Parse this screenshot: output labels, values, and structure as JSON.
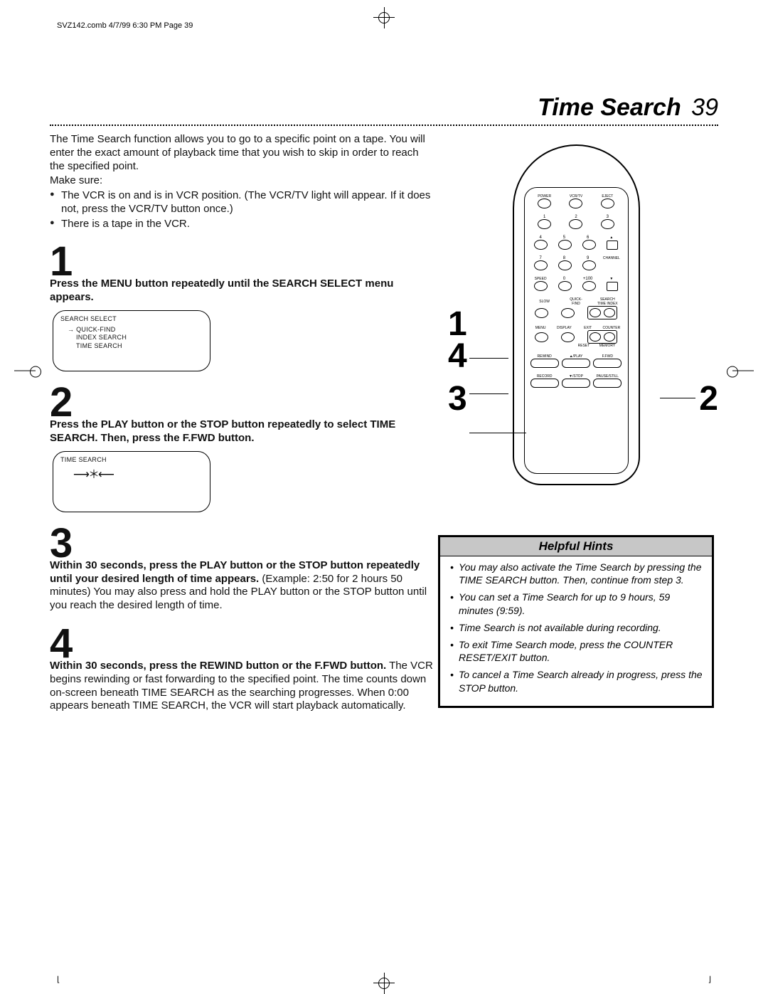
{
  "slug": "SVZ142.comb  4/7/99  6:30 PM  Page 39",
  "title": "Time Search",
  "page_number": "39",
  "intro": "The Time Search function allows you to go to a specific point on a tape. You will enter the exact amount of playback time that you wish to skip in order to reach the specified point.",
  "make_sure_label": "Make sure:",
  "make_sure": [
    "The VCR is on and is in VCR position. (The VCR/TV light will appear. If it does not, press the VCR/TV button once.)",
    "There is a tape in the VCR."
  ],
  "steps": {
    "s1": {
      "num": "1",
      "bold": "Press the MENU button repeatedly until the SEARCH SELECT menu appears."
    },
    "s2": {
      "num": "2",
      "bold": "Press the PLAY button or the STOP button repeatedly to select TIME SEARCH. Then, press the F.FWD button."
    },
    "s3": {
      "num": "3",
      "bold": "Within 30 seconds, press the PLAY button or the STOP button repeatedly until your desired length of time appears.",
      "rest": "  (Example: 2:50 for 2 hours 50 minutes) You may also press and hold the PLAY button or the STOP button until you reach the desired length of time."
    },
    "s4": {
      "num": "4",
      "bold": "Within 30 seconds, press the REWIND button or the F.FWD button.",
      "rest": " The VCR begins rewinding or fast forwarding to the specified point. The time counts down on-screen beneath TIME SEARCH as the searching progresses. When 0:00 appears beneath TIME SEARCH, the VCR will start playback automatically."
    }
  },
  "osd1": {
    "hdr": "SEARCH SELECT",
    "rows": [
      "→  QUICK-FIND",
      "INDEX SEARCH",
      "TIME SEARCH"
    ]
  },
  "osd2": {
    "hdr": "TIME SEARCH"
  },
  "remote_labels": {
    "power": "POWER",
    "vcrtv": "VCR/TV",
    "eject": "EJECT",
    "n1": "1",
    "n2": "2",
    "n3": "3",
    "n4": "4",
    "n5": "5",
    "n6": "6",
    "n7": "7",
    "n8": "8",
    "n9": "9",
    "channel": "CHANNEL",
    "speed": "SPEED",
    "zero": "0",
    "p100": "+100",
    "slow": "SLOW",
    "qf": "QUICK-\nFIND",
    "search": "SEARCH",
    "time": "TIME",
    "index": "INDEX",
    "menu": "MENU",
    "display": "DISPLAY",
    "exit": "EXIT",
    "counter": "COUNTER",
    "reset": "RESET",
    "memory": "MEMORY",
    "rewind": "REWIND",
    "play": "▲/PLAY",
    "ffwd": "F.FWD",
    "record": "RECORD",
    "stop": "▼/STOP",
    "pause": "PAUSE/STILL"
  },
  "pointers": {
    "p1": "1",
    "p2": "2",
    "p3": "3",
    "p4": "4"
  },
  "hints_title": "Helpful Hints",
  "hints": [
    "You may also activate the Time Search by pressing the TIME SEARCH button. Then, continue from step 3.",
    "You can set a Time Search for up to 9 hours, 59 minutes (9:59).",
    "Time Search is not available during recording.",
    "To exit Time Search mode, press the COUNTER RESET/EXIT button.",
    "To cancel a Time Search already in progress, press the STOP button."
  ]
}
